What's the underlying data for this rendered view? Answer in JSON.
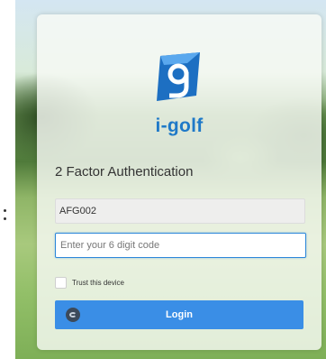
{
  "brand": {
    "name": "i-golf",
    "logo_icon": "g-logo-icon",
    "color": "#1f79c8"
  },
  "auth": {
    "heading": "2 Factor Authentication",
    "username_value": "AFG002",
    "code_placeholder": "Enter your 6 digit code",
    "code_value": "",
    "trust_label": "Trust this device",
    "trust_checked": false,
    "login_label": "Login",
    "login_icon": "spinner-icon",
    "accent_color": "#3a8ee6"
  }
}
